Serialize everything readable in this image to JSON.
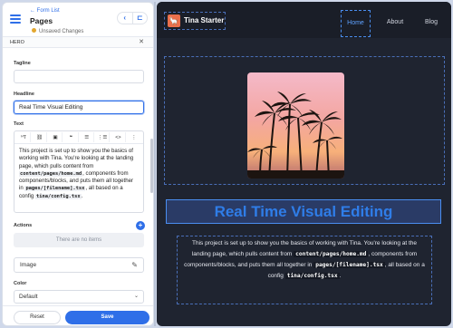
{
  "sidebar": {
    "breadcrumb": "← Form List",
    "page_title": "Pages",
    "status": "Unsaved Changes",
    "section": "HERO",
    "fields": {
      "tagline_label": "Tagline",
      "tagline_value": "",
      "headline_label": "Headline",
      "headline_value": "Real Time Visual Editing",
      "text_label": "Text",
      "text_body_1": "This project is set up to show you the basics of working with Tina. You're looking at the landing page, which pulls content from ",
      "text_code_1": "content/pages/home.md",
      "text_body_2": ", components from components/blocks, and puts them all together in ",
      "text_code_2": "pages/[filename].tsx",
      "text_body_3": ", all based on a config ",
      "text_code_3": "tina/config.tsx",
      "text_body_4": ".",
      "actions_label": "Actions",
      "actions_empty": "There are no items",
      "image_label": "Image",
      "color_label": "Color",
      "color_value": "Default"
    },
    "toolbar": [
      "ᴴT",
      "⛓",
      "▣",
      "❝",
      "☰",
      "⋮☰",
      "<>",
      "⋮"
    ],
    "reset_label": "Reset",
    "save_label": "Save"
  },
  "preview": {
    "brand": "Tina Starter",
    "nav": [
      "Home",
      "About",
      "Blog"
    ],
    "headline": "Real Time Visual Editing",
    "text_1": "This project is set up to show you the basics of working with Tina. You're looking at the landing page, which pulls content from ",
    "code_1": "content/pages/home.md",
    "text_2": ", components from components/blocks, and puts them all together in ",
    "code_2": "pages/[filename].tsx",
    "text_3": ", all based on a config ",
    "code_3": "tina/config.tsx",
    "text_4": "."
  },
  "colors": {
    "accent": "#2f6fe8",
    "preview_bg": "#1f2430",
    "logo": "#ea6f4b"
  }
}
